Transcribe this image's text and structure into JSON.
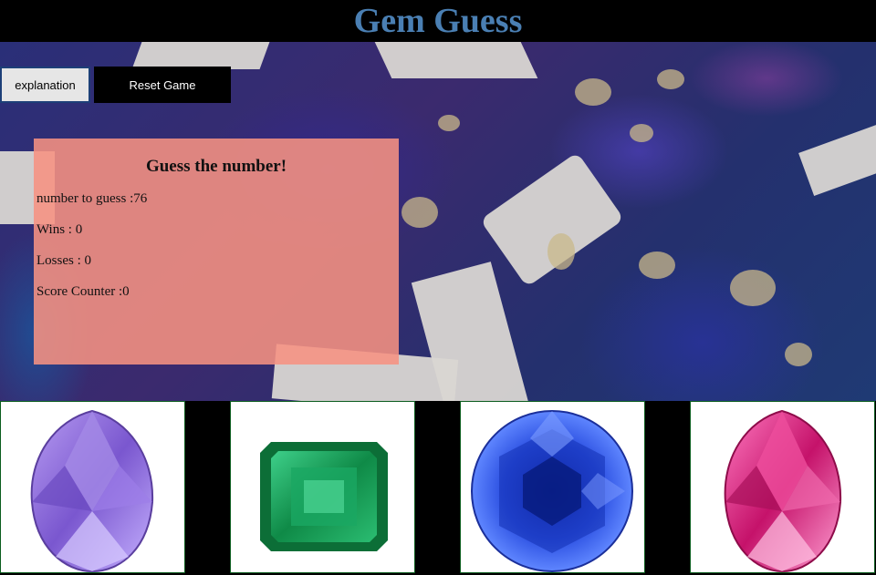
{
  "header": {
    "title": "Gem Guess"
  },
  "controls": {
    "explanation_label": "explanation",
    "reset_label": "Reset Game"
  },
  "panel": {
    "heading": "Guess the number!",
    "target_label": "number to guess :76",
    "wins_label": "Wins : 0",
    "losses_label": "Losses : 0",
    "score_label": "Score Counter :0"
  },
  "gems": [
    {
      "name": "purple gem",
      "color": "#8e6fd8"
    },
    {
      "name": "green gem",
      "color": "#1c9a55"
    },
    {
      "name": "blue gem",
      "color": "#1f3fc9"
    },
    {
      "name": "pink gem",
      "color": "#d8287e"
    }
  ],
  "colors": {
    "title": "#4a7fb3",
    "panel": "#f69282",
    "header_bg": "#000000"
  }
}
